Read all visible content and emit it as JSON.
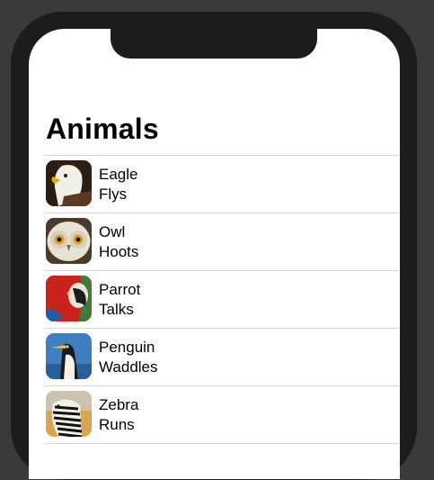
{
  "nav": {
    "title": "Animals"
  },
  "animals": [
    {
      "name": "Eagle",
      "action": "Flys",
      "icon": "eagle-photo"
    },
    {
      "name": "Owl",
      "action": "Hoots",
      "icon": "owl-photo"
    },
    {
      "name": "Parrot",
      "action": "Talks",
      "icon": "parrot-photo"
    },
    {
      "name": "Penguin",
      "action": "Waddles",
      "icon": "penguin-photo"
    },
    {
      "name": "Zebra",
      "action": "Runs",
      "icon": "zebra-photo"
    }
  ],
  "colors": {
    "background": "#3a3a3c",
    "bezel": "#1c1c1e",
    "screen": "#ffffff",
    "separator": "#d9d9d9"
  }
}
